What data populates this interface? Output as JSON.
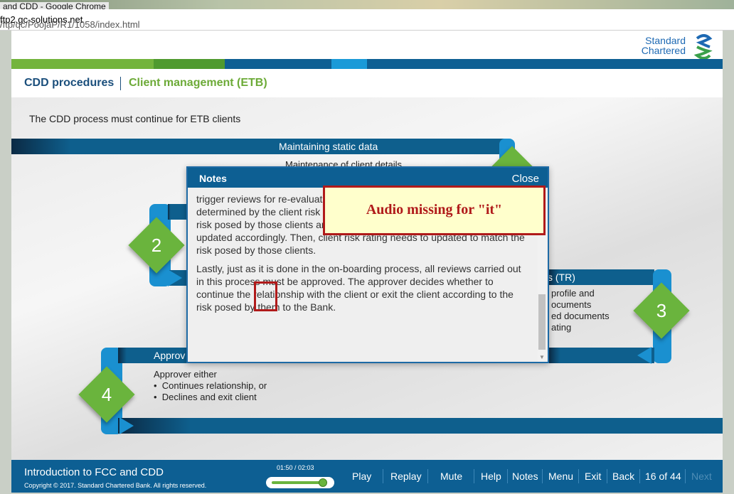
{
  "browser": {
    "title": "and CDD - Google Chrome",
    "url_prefix": "/",
    "url_domain": "ftp2.gc-solutions.net",
    "url_path": "/ftp/qc/PoojaP/R1/1058/index.html"
  },
  "logo": {
    "line1": "Standard",
    "line2": "Chartered"
  },
  "colors": {
    "brand_blue": "#0d5f93",
    "brand_green": "#6ab43d",
    "annotation_red": "#b01a1a"
  },
  "header": {
    "section": "CDD procedures",
    "topic": "Client management (ETB)"
  },
  "content": {
    "intro": "The CDD process must continue for ETB clients",
    "band1_title": "Maintaining static data",
    "band1_peek": "Maintenance of client details",
    "step2": "2",
    "band3_title": "s (TR)",
    "band3_items": [
      "profile and",
      "ocuments",
      "ed documents",
      "ating"
    ],
    "step3": "3",
    "band4_title": "Approv",
    "band4_lead": "Approver either",
    "band4_items": [
      "Continues relationship, or",
      "Declines and exit client"
    ],
    "step4": "4"
  },
  "notes": {
    "title": "Notes",
    "close": "Close",
    "paragraph1": "trigger reviews for re-evaluation. Otherwise, periodic risk reviews are determined by the client risk rating. They are performed to re-evaluate the risk posed by those clients and client information and documents are updated accordingly. Then, client risk rating needs to updated to match the risk posed by those clients.",
    "paragraph2": "Lastly, just as it is done in the on-boarding process, all reviews carried out in this process must be approved. The approver decides whether to continue the relationship with the client or exit the client according to the risk posed by them to the Bank."
  },
  "annotation": {
    "text": "Audio missing for \"it\""
  },
  "footer": {
    "course_title": "Introduction to FCC and CDD",
    "copyright": "Copyright © 2017. Standard Chartered Bank. All rights reserved.",
    "timer": "01:50 / 02:03",
    "progress": 0.894,
    "play": "Play",
    "replay": "Replay",
    "mute": "Mute",
    "help": "Help",
    "notes": "Notes",
    "menu": "Menu",
    "exit": "Exit",
    "back": "Back",
    "page": "16 of 44",
    "next": "Next"
  }
}
